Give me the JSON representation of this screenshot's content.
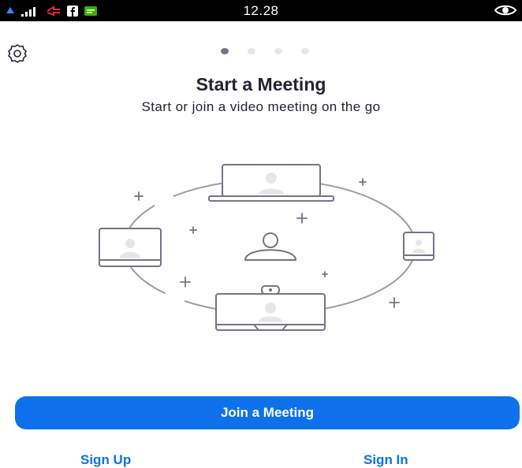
{
  "status_bar": {
    "time": "12.28",
    "icons": [
      "notification-icon",
      "signal-icon",
      "data-icon",
      "facebook-icon",
      "message-icon",
      "eye-icon"
    ]
  },
  "colors": {
    "primary": "#0e71eb",
    "title_text": "#232333",
    "illustration_stroke": "#747487",
    "illustration_fill": "#e6e6ea"
  },
  "onboarding": {
    "page_count": 4,
    "active_page": 1,
    "title": "Start a Meeting",
    "subtitle": "Start or join a video meeting on the go"
  },
  "actions": {
    "join_label": "Join a Meeting",
    "sign_up_label": "Sign Up",
    "sign_in_label": "Sign In"
  }
}
